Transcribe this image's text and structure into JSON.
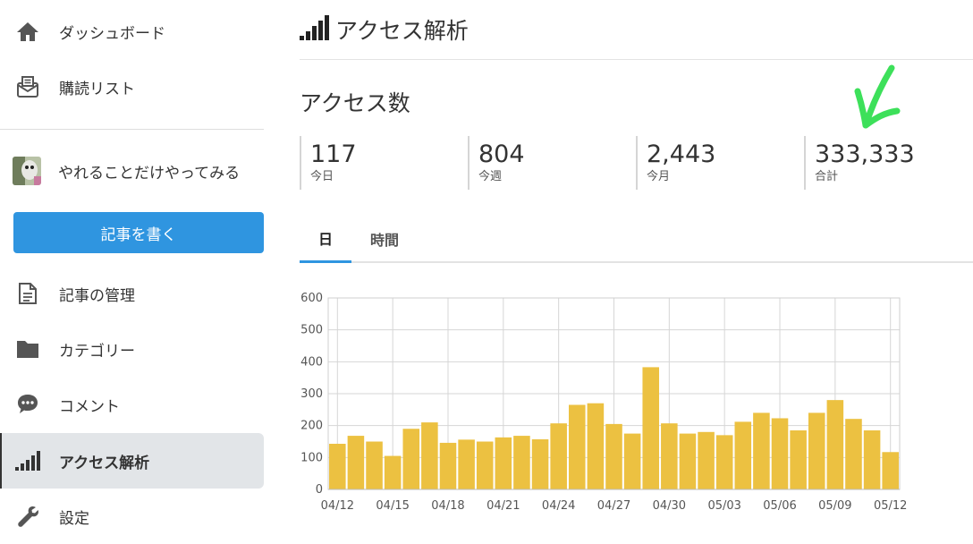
{
  "sidebar": {
    "nav_top": [
      {
        "label": "ダッシュボード",
        "icon": "home-icon"
      },
      {
        "label": "購読リスト",
        "icon": "subscription-icon"
      }
    ],
    "blog_name": "やれることだけやってみる",
    "write_button": "記事を書く",
    "nav_bottom": [
      {
        "label": "記事の管理",
        "icon": "document-icon"
      },
      {
        "label": "カテゴリー",
        "icon": "folder-icon"
      },
      {
        "label": "コメント",
        "icon": "comment-icon"
      },
      {
        "label": "アクセス解析",
        "icon": "signal-bars-icon",
        "active": true
      },
      {
        "label": "設定",
        "icon": "wrench-icon"
      }
    ]
  },
  "header": {
    "title": "アクセス解析",
    "icon": "signal-bars-icon"
  },
  "section": {
    "title": "アクセス数"
  },
  "stats": [
    {
      "value": "117",
      "label": "今日"
    },
    {
      "value": "804",
      "label": "今週"
    },
    {
      "value": "2,443",
      "label": "今月"
    },
    {
      "value": "333,333",
      "label": "合計"
    }
  ],
  "tabs": [
    {
      "label": "日",
      "active": true
    },
    {
      "label": "時間",
      "active": false
    }
  ],
  "colors": {
    "accent": "#2f95e0",
    "bar": "#ecc141",
    "annotation": "#3de05a"
  },
  "chart_data": {
    "type": "bar",
    "ylim": [
      0,
      600
    ],
    "yticks": [
      0,
      100,
      200,
      300,
      400,
      500,
      600
    ],
    "x_tick_labels": [
      "04/12",
      "04/15",
      "04/18",
      "04/21",
      "04/24",
      "04/27",
      "04/30",
      "05/03",
      "05/06",
      "05/09",
      "05/12"
    ],
    "categories": [
      "04/12",
      "04/13",
      "04/14",
      "04/15",
      "04/16",
      "04/17",
      "04/18",
      "04/19",
      "04/20",
      "04/21",
      "04/22",
      "04/23",
      "04/24",
      "04/25",
      "04/26",
      "04/27",
      "04/28",
      "04/29",
      "04/30",
      "05/01",
      "05/02",
      "05/03",
      "05/04",
      "05/05",
      "05/06",
      "05/07",
      "05/08",
      "05/09",
      "05/10",
      "05/11",
      "05/12"
    ],
    "values": [
      143,
      168,
      150,
      105,
      190,
      210,
      146,
      156,
      150,
      163,
      168,
      157,
      207,
      265,
      270,
      205,
      175,
      383,
      207,
      175,
      180,
      170,
      212,
      240,
      223,
      185,
      240,
      280,
      221,
      185,
      117
    ],
    "grid": true
  }
}
